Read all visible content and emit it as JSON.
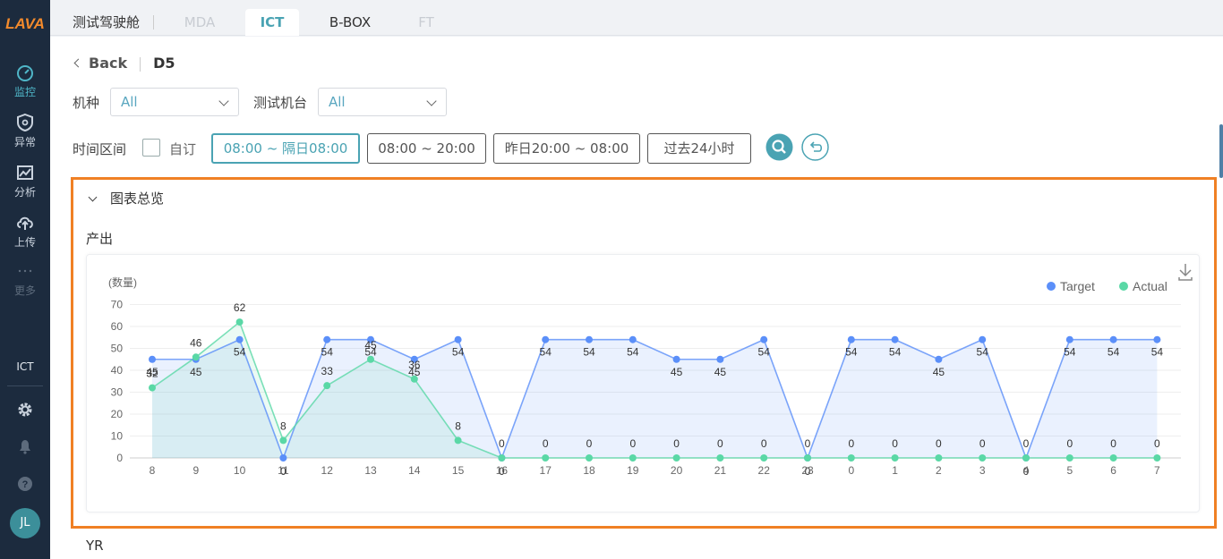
{
  "sidebar": {
    "logo_text": "LAVA",
    "items": [
      {
        "label": "监控",
        "icon": "dashboard-icon",
        "active": true
      },
      {
        "label": "异常",
        "icon": "shield-icon",
        "active": false
      },
      {
        "label": "分析",
        "icon": "chart-icon",
        "active": false
      },
      {
        "label": "上传",
        "icon": "upload-icon",
        "active": false
      },
      {
        "label": "更多",
        "icon": "more-icon",
        "active": false
      }
    ],
    "section_label": "ICT",
    "avatar_initials": "JL"
  },
  "topbar": {
    "title": "测试驾驶舱",
    "tabs": [
      "MDA",
      "ICT",
      "B-BOX",
      "FT"
    ],
    "active_tab": "ICT"
  },
  "breadcrumb": {
    "back": "Back",
    "current": "D5"
  },
  "filters": {
    "model_label": "机种",
    "model_value": "All",
    "station_label": "测试机台",
    "station_value": "All",
    "time_label": "时间区间",
    "custom_label": "自订",
    "ranges": [
      "08:00 ~ 隔日08:00",
      "08:00 ~ 20:00",
      "昨日20:00 ~ 08:00",
      "过去24小时"
    ],
    "active_range": "08:00 ~ 隔日08:00"
  },
  "panel": {
    "title": "图表总览",
    "subtitle": "产出",
    "next_section": "YR"
  },
  "colors": {
    "accent": "#4aa3b3",
    "target": "#5b8ff9",
    "actual": "#5ad8a6",
    "highlight": "#f08024"
  },
  "chart_data": {
    "type": "area",
    "yunit": "(数量)",
    "ylim": [
      0,
      70
    ],
    "yticks": [
      0,
      10,
      20,
      30,
      40,
      50,
      60,
      70
    ],
    "categories": [
      "8",
      "9",
      "10",
      "11",
      "12",
      "13",
      "14",
      "15",
      "16",
      "17",
      "18",
      "19",
      "20",
      "21",
      "22",
      "23",
      "0",
      "1",
      "2",
      "3",
      "4",
      "5",
      "6",
      "7"
    ],
    "legend_position": "top-right",
    "series": [
      {
        "name": "Target",
        "values": [
          45,
          45,
          54,
          0,
          54,
          54,
          45,
          54,
          0,
          54,
          54,
          54,
          45,
          45,
          54,
          0,
          54,
          54,
          45,
          54,
          0,
          54,
          54,
          54
        ]
      },
      {
        "name": "Actual",
        "values": [
          32,
          46,
          62,
          8,
          33,
          45,
          36,
          8,
          0,
          0,
          0,
          0,
          0,
          0,
          0,
          0,
          0,
          0,
          0,
          0,
          0,
          0,
          0,
          0
        ]
      }
    ]
  }
}
